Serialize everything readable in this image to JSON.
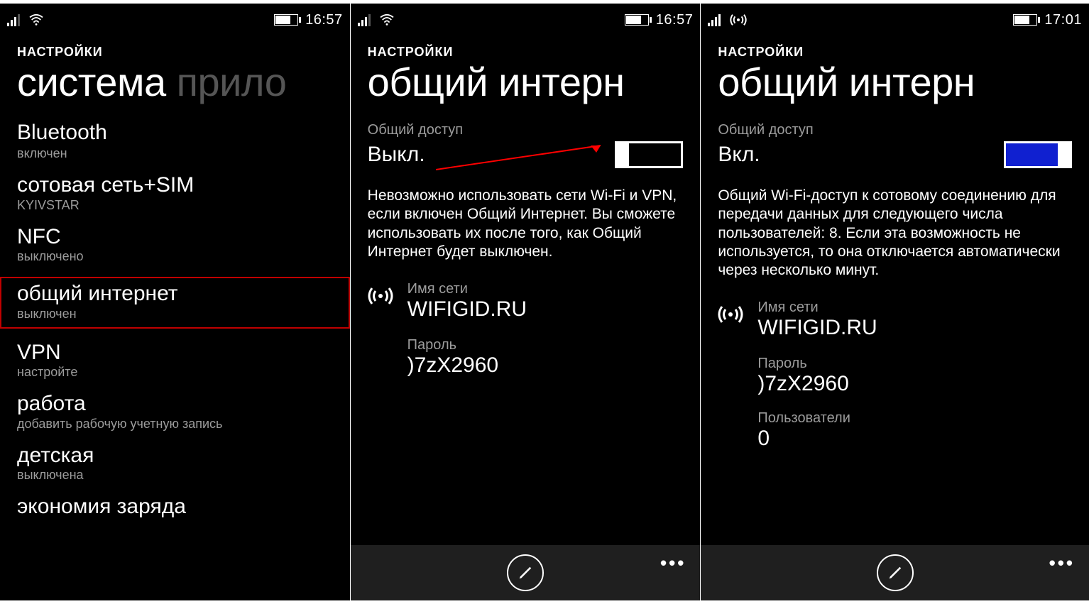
{
  "screens": {
    "s1": {
      "time": "16:57",
      "crumb": "НАСТРОЙКИ",
      "pivot_main": "система",
      "pivot_dim": "прило",
      "items": {
        "bt": {
          "title": "",
          "sub": "включен"
        },
        "cell": {
          "title": "сотовая сеть+SIM",
          "sub": "KYIVSTAR"
        },
        "nfc": {
          "title": "NFC",
          "sub": "выключено"
        },
        "hotspot": {
          "title": "общий интернет",
          "sub": "выключен"
        },
        "vpn": {
          "title": "VPN",
          "sub": "настройте"
        },
        "work": {
          "title": "работа",
          "sub": "добавить рабочую учетную запись"
        },
        "kids": {
          "title": "детская",
          "sub": "выключена"
        },
        "batt": {
          "title": "экономия заряда",
          "sub": ""
        }
      }
    },
    "s2": {
      "time": "16:57",
      "crumb": "НАСТРОЙКИ",
      "pivot": "общий интерн",
      "share_label": "Общий доступ",
      "share_state": "Выкл.",
      "desc": "Невозможно использовать сети Wi-Fi и VPN, если включен Общий Интернет. Вы сможете использовать их после того, как Общий Интернет будет выключен.",
      "net_label": "Имя сети",
      "net_value": "WIFIGID.RU",
      "pwd_label": "Пароль",
      "pwd_value": ")7zX2960"
    },
    "s3": {
      "time": "17:01",
      "crumb": "НАСТРОЙКИ",
      "pivot": "общий интерн",
      "share_label": "Общий доступ",
      "share_state": "Вкл.",
      "desc": "Общий Wi-Fi-доступ к сотовому соединению для передачи данных для следующего числа пользователей: 8. Если эта возможность не используется, то она отключается автоматически через несколько минут.",
      "net_label": "Имя сети",
      "net_value": "WIFIGID.RU",
      "pwd_label": "Пароль",
      "pwd_value": ")7zX2960",
      "users_label": "Пользователи",
      "users_value": "0"
    }
  }
}
